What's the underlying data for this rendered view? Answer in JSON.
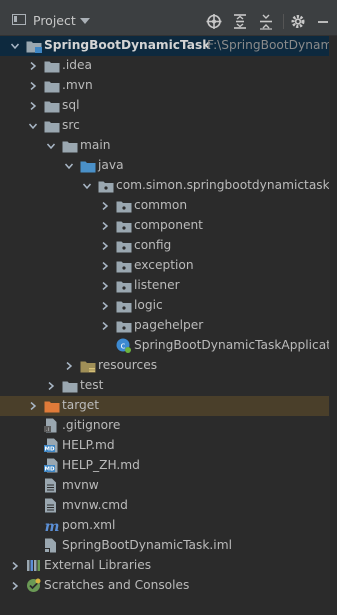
{
  "toolbar": {
    "view_label": "Project",
    "icons": [
      "locate-icon",
      "expand-all-icon",
      "collapse-all-icon",
      "gear-icon",
      "minimize-icon"
    ]
  },
  "tree": [
    {
      "label": "SpringBootDynamicTask",
      "sub": "F:\\SpringBootDynamicT",
      "depth": 0,
      "arrow": "down",
      "icon": "module-folder",
      "selected": true,
      "bold": true
    },
    {
      "label": ".idea",
      "depth": 1,
      "arrow": "right",
      "icon": "folder"
    },
    {
      "label": ".mvn",
      "depth": 1,
      "arrow": "right",
      "icon": "folder"
    },
    {
      "label": "sql",
      "depth": 1,
      "arrow": "right",
      "icon": "folder"
    },
    {
      "label": "src",
      "depth": 1,
      "arrow": "down",
      "icon": "folder"
    },
    {
      "label": "main",
      "depth": 2,
      "arrow": "down",
      "icon": "folder"
    },
    {
      "label": "java",
      "depth": 3,
      "arrow": "down",
      "icon": "source-folder"
    },
    {
      "label": "com.simon.springbootdynamictask",
      "depth": 4,
      "arrow": "down",
      "icon": "package"
    },
    {
      "label": "common",
      "depth": 5,
      "arrow": "right",
      "icon": "package"
    },
    {
      "label": "component",
      "depth": 5,
      "arrow": "right",
      "icon": "package"
    },
    {
      "label": "config",
      "depth": 5,
      "arrow": "right",
      "icon": "package"
    },
    {
      "label": "exception",
      "depth": 5,
      "arrow": "right",
      "icon": "package"
    },
    {
      "label": "listener",
      "depth": 5,
      "arrow": "right",
      "icon": "package"
    },
    {
      "label": "logic",
      "depth": 5,
      "arrow": "right",
      "icon": "package"
    },
    {
      "label": "pagehelper",
      "depth": 5,
      "arrow": "right",
      "icon": "package"
    },
    {
      "label": "SpringBootDynamicTaskApplicatio",
      "depth": 5,
      "arrow": "none",
      "icon": "spring-class"
    },
    {
      "label": "resources",
      "depth": 3,
      "arrow": "right",
      "icon": "resources-folder"
    },
    {
      "label": "test",
      "depth": 2,
      "arrow": "right",
      "icon": "folder"
    },
    {
      "label": "target",
      "depth": 1,
      "arrow": "right",
      "icon": "excluded-folder",
      "target": true
    },
    {
      "label": ".gitignore",
      "depth": 1,
      "arrow": "none",
      "icon": "gitignore-file"
    },
    {
      "label": "HELP.md",
      "depth": 1,
      "arrow": "none",
      "icon": "markdown-file"
    },
    {
      "label": "HELP_ZH.md",
      "depth": 1,
      "arrow": "none",
      "icon": "markdown-file"
    },
    {
      "label": "mvnw",
      "depth": 1,
      "arrow": "none",
      "icon": "text-file"
    },
    {
      "label": "mvnw.cmd",
      "depth": 1,
      "arrow": "none",
      "icon": "text-file"
    },
    {
      "label": "pom.xml",
      "depth": 1,
      "arrow": "none",
      "icon": "maven-file"
    },
    {
      "label": "SpringBootDynamicTask.iml",
      "depth": 1,
      "arrow": "none",
      "icon": "iml-file"
    },
    {
      "label": "External Libraries",
      "depth": 0,
      "arrow": "right",
      "icon": "libraries"
    },
    {
      "label": "Scratches and Consoles",
      "depth": 0,
      "arrow": "right",
      "icon": "scratches"
    }
  ],
  "colors": {
    "folder": "#9aa7b0",
    "source_folder": "#4a90c8",
    "resources_folder": "#a08f57",
    "excluded_folder": "#e07b39",
    "selected_row": "#0d293e",
    "text": "#bbbbbb"
  }
}
